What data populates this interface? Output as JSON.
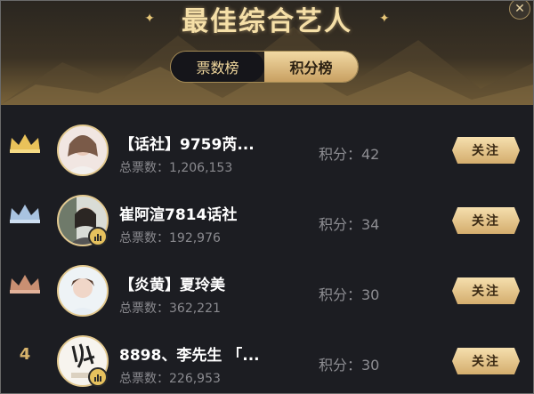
{
  "header": {
    "title": "最佳综合艺人",
    "close_icon": "close-icon",
    "colors": {
      "gold": "#f5dfa7",
      "dark": "#1c1d22"
    }
  },
  "tabs": [
    {
      "label": "票数榜",
      "active": true
    },
    {
      "label": "积分榜",
      "active": false
    }
  ],
  "rows": [
    {
      "rank_icon": "gold-crown-icon",
      "name": "【话社】9759芮...",
      "votes": "总票数：1,206,153",
      "score": "积分：42",
      "follow": "关注",
      "badge": false
    },
    {
      "rank_icon": "silver-crown-icon",
      "name": "崔阿渲7814话社",
      "votes": "总票数：192,976",
      "score": "积分：34",
      "follow": "关注",
      "badge": true
    },
    {
      "rank_icon": "bronze-crown-icon",
      "name": "【炎黄】夏玲美",
      "votes": "总票数：362,221",
      "score": "积分：30",
      "follow": "关注",
      "badge": false
    },
    {
      "rank": "4",
      "name": "8898、李先生 「...",
      "votes": "总票数：226,953",
      "score": "积分：30",
      "follow": "关注",
      "badge": true
    }
  ]
}
